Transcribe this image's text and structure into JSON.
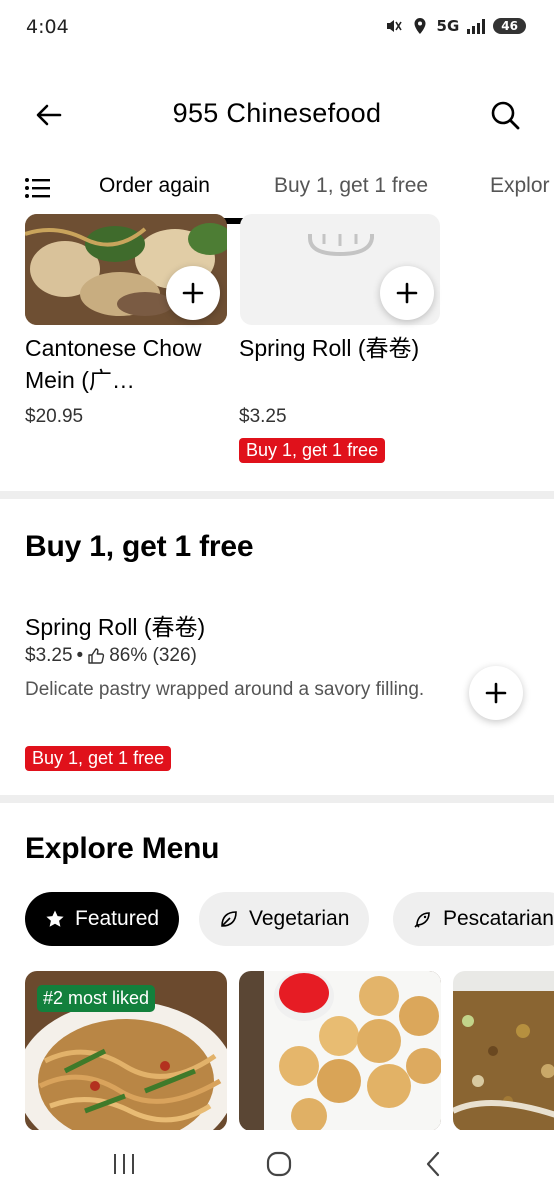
{
  "status_bar": {
    "time": "4:04",
    "network": "5G",
    "battery": "46"
  },
  "header": {
    "title": "955 Chinesefood"
  },
  "tabs": [
    {
      "label": "Order again"
    },
    {
      "label": "Buy 1, get 1 free"
    },
    {
      "label": "Explor"
    }
  ],
  "order_again": [
    {
      "name": "Cantonese Chow Mein (广…",
      "price": "$20.95"
    },
    {
      "name": "Spring Roll (春卷)",
      "price": "$3.25",
      "badge": "Buy 1, get 1 free"
    }
  ],
  "bogo_section": {
    "title": "Buy 1, get 1 free",
    "item": {
      "name": "Spring Roll (春卷)",
      "price": "$3.25",
      "separator": "•",
      "rating": "86% (326)",
      "description": "Delicate pastry wrapped around a savory filling.",
      "badge": "Buy 1, get 1 free"
    }
  },
  "explore_menu": {
    "title": "Explore Menu",
    "chips": [
      {
        "label": "Featured",
        "icon": "star-icon",
        "active": true
      },
      {
        "label": "Vegetarian",
        "icon": "leaf-icon",
        "active": false
      },
      {
        "label": "Pescatarian",
        "icon": "fish-icon",
        "active": false
      }
    ],
    "tiles": [
      {
        "badge": "#2 most liked"
      },
      {
        "badge": ""
      },
      {
        "badge": ""
      }
    ]
  },
  "colors": {
    "accent": "#000000",
    "promo": "#e0111b",
    "liked": "#12803c"
  }
}
